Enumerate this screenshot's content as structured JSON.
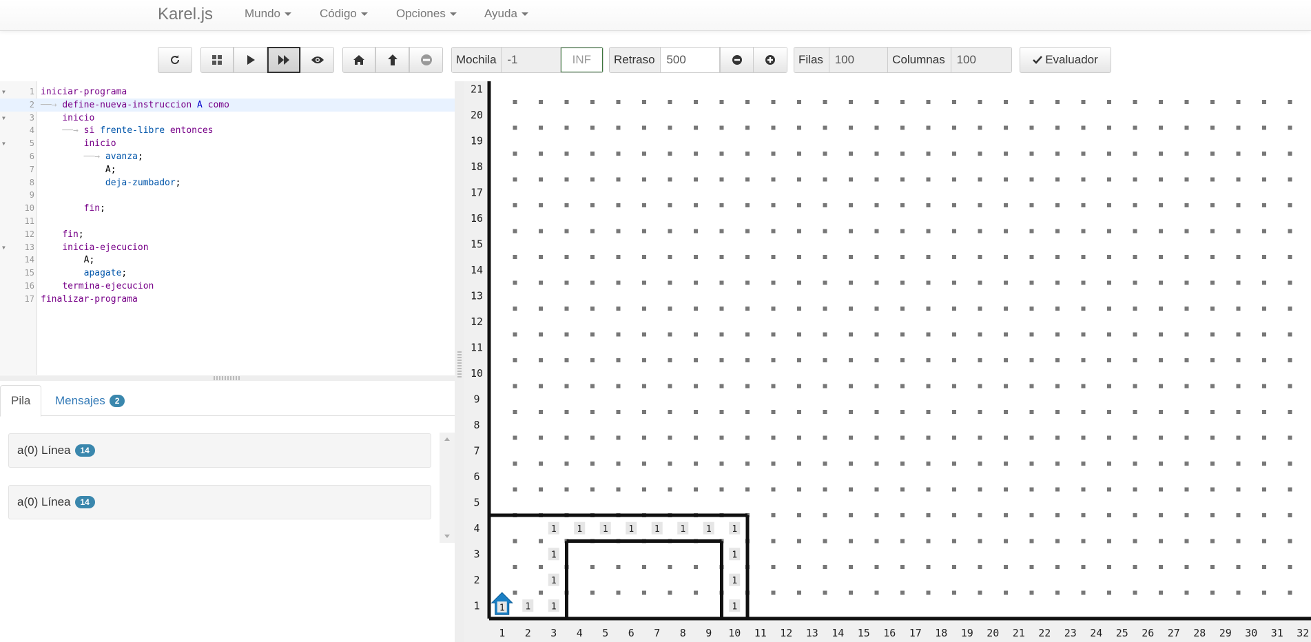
{
  "navbar": {
    "brand": "Karel.js",
    "menus": [
      "Mundo",
      "Código",
      "Opciones",
      "Ayuda"
    ]
  },
  "toolbar": {
    "buttons": [
      "reload-icon",
      "grid-icon",
      "play-icon",
      "fast-forward-icon",
      "eye-icon",
      "home-icon",
      "arrow-up-icon",
      "minus-circle-icon"
    ],
    "mochila_label": "Mochila",
    "mochila_value": "-1",
    "mochila_inf": "INF",
    "retraso_label": "Retraso",
    "retraso_value": "500",
    "filas_label": "Filas",
    "filas_value": "100",
    "columnas_label": "Columnas",
    "columnas_value": "100",
    "evaluador_label": "Evaluador"
  },
  "editor": {
    "lines": [
      {
        "n": "1",
        "fold": true,
        "indent": "",
        "parts": [
          [
            "kw",
            "iniciar-programa"
          ]
        ]
      },
      {
        "n": "2",
        "fold": false,
        "indent": "    ",
        "arrow": true,
        "parts": [
          [
            "kw",
            "define-nueva-instruccion"
          ],
          [
            "sym",
            " "
          ],
          [
            "bl",
            "A"
          ],
          [
            "sym",
            " "
          ],
          [
            "kw",
            "como"
          ]
        ]
      },
      {
        "n": "3",
        "fold": true,
        "indent": "    ",
        "parts": [
          [
            "kw",
            "inicio"
          ]
        ]
      },
      {
        "n": "4",
        "fold": false,
        "indent": "        ",
        "arrow": true,
        "parts": [
          [
            "kw",
            "si"
          ],
          [
            "sym",
            " "
          ],
          [
            "fn",
            "frente-libre"
          ],
          [
            "sym",
            " "
          ],
          [
            "kw",
            "entonces"
          ]
        ]
      },
      {
        "n": "5",
        "fold": true,
        "indent": "        ",
        "parts": [
          [
            "kw",
            "inicio"
          ]
        ]
      },
      {
        "n": "6",
        "fold": false,
        "indent": "            ",
        "arrow": true,
        "parts": [
          [
            "fn",
            "avanza"
          ],
          [
            "sym",
            ";"
          ]
        ]
      },
      {
        "n": "7",
        "fold": false,
        "indent": "            ",
        "parts": [
          [
            "sym",
            "A;"
          ]
        ]
      },
      {
        "n": "8",
        "fold": false,
        "indent": "            ",
        "parts": [
          [
            "fn",
            "deja-zumbador"
          ],
          [
            "sym",
            ";"
          ]
        ]
      },
      {
        "n": "9",
        "fold": false,
        "indent": "",
        "parts": []
      },
      {
        "n": "10",
        "fold": false,
        "indent": "        ",
        "parts": [
          [
            "kw",
            "fin"
          ],
          [
            "sym",
            ";"
          ]
        ]
      },
      {
        "n": "11",
        "fold": false,
        "indent": "",
        "parts": []
      },
      {
        "n": "12",
        "fold": false,
        "indent": "    ",
        "parts": [
          [
            "kw",
            "fin"
          ],
          [
            "sym",
            ";"
          ]
        ]
      },
      {
        "n": "13",
        "fold": true,
        "indent": "    ",
        "parts": [
          [
            "kw",
            "inicia-ejecucion"
          ]
        ]
      },
      {
        "n": "14",
        "fold": false,
        "indent": "        ",
        "parts": [
          [
            "sym",
            "A;"
          ]
        ]
      },
      {
        "n": "15",
        "fold": false,
        "indent": "        ",
        "parts": [
          [
            "fn",
            "apagate"
          ],
          [
            "sym",
            ";"
          ]
        ]
      },
      {
        "n": "16",
        "fold": false,
        "indent": "    ",
        "parts": [
          [
            "kw",
            "termina-ejecucion"
          ]
        ]
      },
      {
        "n": "17",
        "fold": false,
        "indent": "",
        "parts": [
          [
            "kw",
            "finalizar-programa"
          ]
        ]
      }
    ]
  },
  "tabs": {
    "pila": "Pila",
    "mensajes": "Mensajes",
    "mensajes_count": "2"
  },
  "stack": [
    {
      "label": "a(0) Línea",
      "badge": "14"
    },
    {
      "label": "a(0) Línea",
      "badge": "14"
    }
  ],
  "world": {
    "rows": 21,
    "cols": 32,
    "karel": {
      "row": 1,
      "col": 1,
      "facing": "north"
    },
    "beepers": [
      {
        "r": 1,
        "c": 1,
        "n": "1"
      },
      {
        "r": 1,
        "c": 2,
        "n": "1"
      },
      {
        "r": 1,
        "c": 3,
        "n": "1"
      },
      {
        "r": 2,
        "c": 3,
        "n": "1"
      },
      {
        "r": 3,
        "c": 3,
        "n": "1"
      },
      {
        "r": 4,
        "c": 3,
        "n": "1"
      },
      {
        "r": 4,
        "c": 4,
        "n": "1"
      },
      {
        "r": 4,
        "c": 5,
        "n": "1"
      },
      {
        "r": 4,
        "c": 6,
        "n": "1"
      },
      {
        "r": 4,
        "c": 7,
        "n": "1"
      },
      {
        "r": 4,
        "c": 8,
        "n": "1"
      },
      {
        "r": 4,
        "c": 9,
        "n": "1"
      },
      {
        "r": 4,
        "c": 10,
        "n": "1"
      },
      {
        "r": 3,
        "c": 10,
        "n": "1"
      },
      {
        "r": 2,
        "c": 10,
        "n": "1"
      },
      {
        "r": 1,
        "c": 10,
        "n": "1"
      }
    ],
    "walls": {
      "horizontal_after_row": [
        {
          "row": 4,
          "from": 1,
          "to": 10
        },
        {
          "row": 3,
          "from": 4,
          "to": 9
        }
      ],
      "vertical_after_col": [
        {
          "col": 10,
          "from": 1,
          "to": 4
        },
        {
          "col": 3,
          "from": 1,
          "to": 3
        },
        {
          "col": 9,
          "from": 1,
          "to": 3
        }
      ]
    }
  }
}
